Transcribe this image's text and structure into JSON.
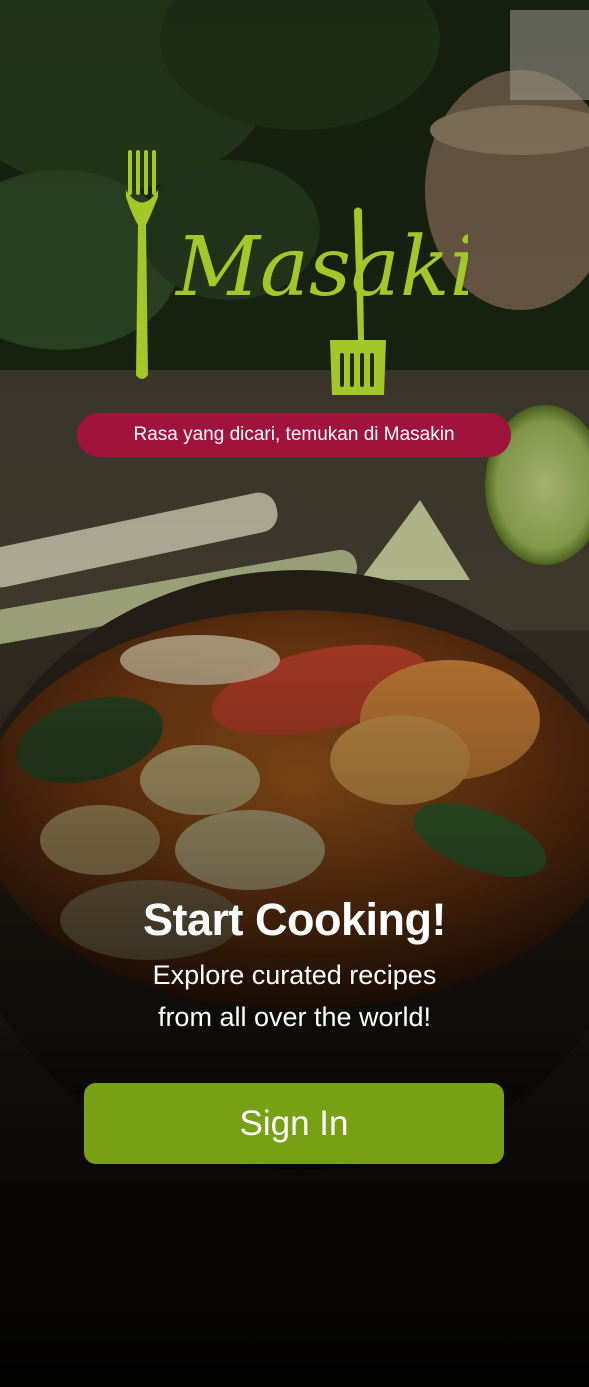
{
  "brand": {
    "logo_text": "Masakin",
    "logo_color": "#a3c628",
    "tagline": "Rasa yang dicari, temukan di Masakin",
    "tagline_bg": "#a0133d"
  },
  "hero": {
    "headline": "Start Cooking!",
    "subtitle_line1": "Explore curated recipes",
    "subtitle_line2": "from all over the world!"
  },
  "actions": {
    "sign_in_label": "Sign In",
    "sign_in_color": "#78a015"
  },
  "background": {
    "icon": "tom-yum-soup-bowl-photo"
  }
}
